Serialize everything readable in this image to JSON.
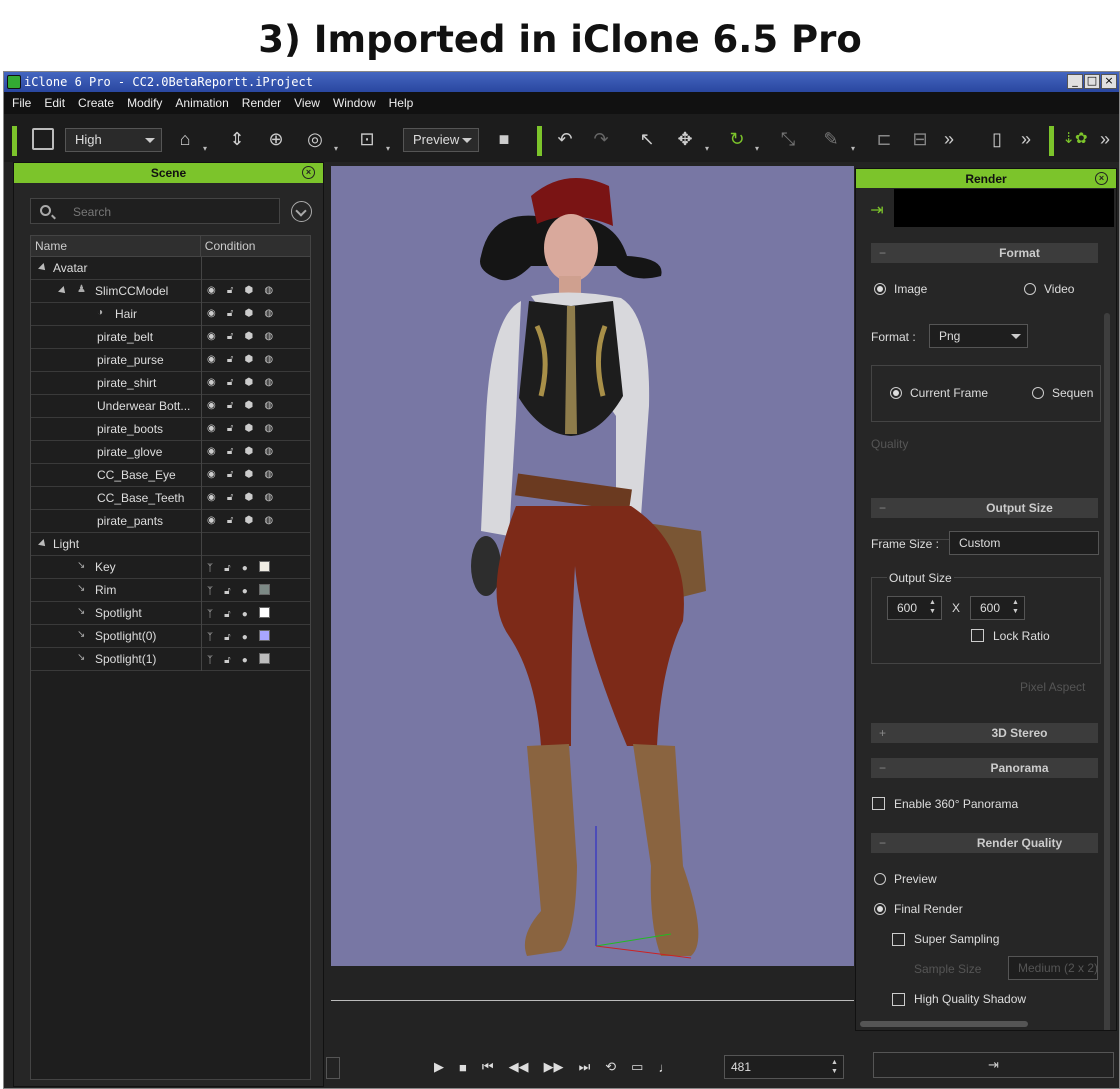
{
  "heading": "3) Imported in iClone 6.5 Pro",
  "window": {
    "title": "iClone 6 Pro - CC2.0BetaReportt.iProject"
  },
  "menu": [
    "File",
    "Edit",
    "Create",
    "Modify",
    "Animation",
    "Render",
    "View",
    "Window",
    "Help"
  ],
  "toolbar": {
    "quality": "High",
    "preview": "Preview"
  },
  "scene": {
    "title": "Scene",
    "search_placeholder": "Search",
    "columns": [
      "Name",
      "Condition"
    ],
    "rows": [
      {
        "name": "Avatar",
        "level": 0,
        "type": "group"
      },
      {
        "name": "SlimCCModel",
        "level": 1,
        "type": "avatar"
      },
      {
        "name": "Hair",
        "level": 2,
        "type": "hair"
      },
      {
        "name": "pirate_belt",
        "level": 2,
        "type": "item"
      },
      {
        "name": "pirate_purse",
        "level": 2,
        "type": "item"
      },
      {
        "name": "pirate_shirt",
        "level": 2,
        "type": "item"
      },
      {
        "name": "Underwear Bott...",
        "level": 2,
        "type": "item"
      },
      {
        "name": "pirate_boots",
        "level": 2,
        "type": "item"
      },
      {
        "name": "pirate_glove",
        "level": 2,
        "type": "item"
      },
      {
        "name": "CC_Base_Eye",
        "level": 2,
        "type": "item"
      },
      {
        "name": "CC_Base_Teeth",
        "level": 2,
        "type": "item"
      },
      {
        "name": "pirate_pants",
        "level": 2,
        "type": "item"
      },
      {
        "name": "Light",
        "level": 0,
        "type": "group"
      },
      {
        "name": "Key",
        "level": 1,
        "type": "light",
        "swatch": "#f0ede4"
      },
      {
        "name": "Rim",
        "level": 1,
        "type": "light",
        "swatch": "#7d8a86"
      },
      {
        "name": "Spotlight",
        "level": 1,
        "type": "light",
        "swatch": "#ffffff"
      },
      {
        "name": "Spotlight(0)",
        "level": 1,
        "type": "light",
        "swatch": "#a8a6ff"
      },
      {
        "name": "Spotlight(1)",
        "level": 1,
        "type": "light",
        "swatch": "#bdbdbd"
      }
    ]
  },
  "playback": {
    "frame": "481"
  },
  "render": {
    "title": "Render",
    "format_section": "Format",
    "image": "Image",
    "video": "Video",
    "format_label": "Format :",
    "format_value": "Png",
    "current_frame": "Current Frame",
    "sequence": "Sequen",
    "quality": "Quality",
    "output_size_section": "Output Size",
    "frame_size_label": "Frame Size :",
    "frame_size_value": "Custom",
    "output_size_label": "Output Size",
    "width": "600",
    "times": "X",
    "height": "600",
    "lock_ratio": "Lock Ratio",
    "pixel_aspect": "Pixel Aspect",
    "stereo_section": "3D Stereo",
    "panorama_section": "Panorama",
    "enable_panorama": "Enable 360° Panorama",
    "quality_section": "Render Quality",
    "preview": "Preview",
    "final_render": "Final Render",
    "super_sampling": "Super Sampling",
    "sample_size": "Sample Size",
    "sample_value": "Medium (2 x 2)",
    "hq_shadow": "High Quality Shadow"
  },
  "colors": {
    "accent": "#7cc42b",
    "viewport_bg": "#7877a4",
    "panel_bg": "#262626"
  }
}
